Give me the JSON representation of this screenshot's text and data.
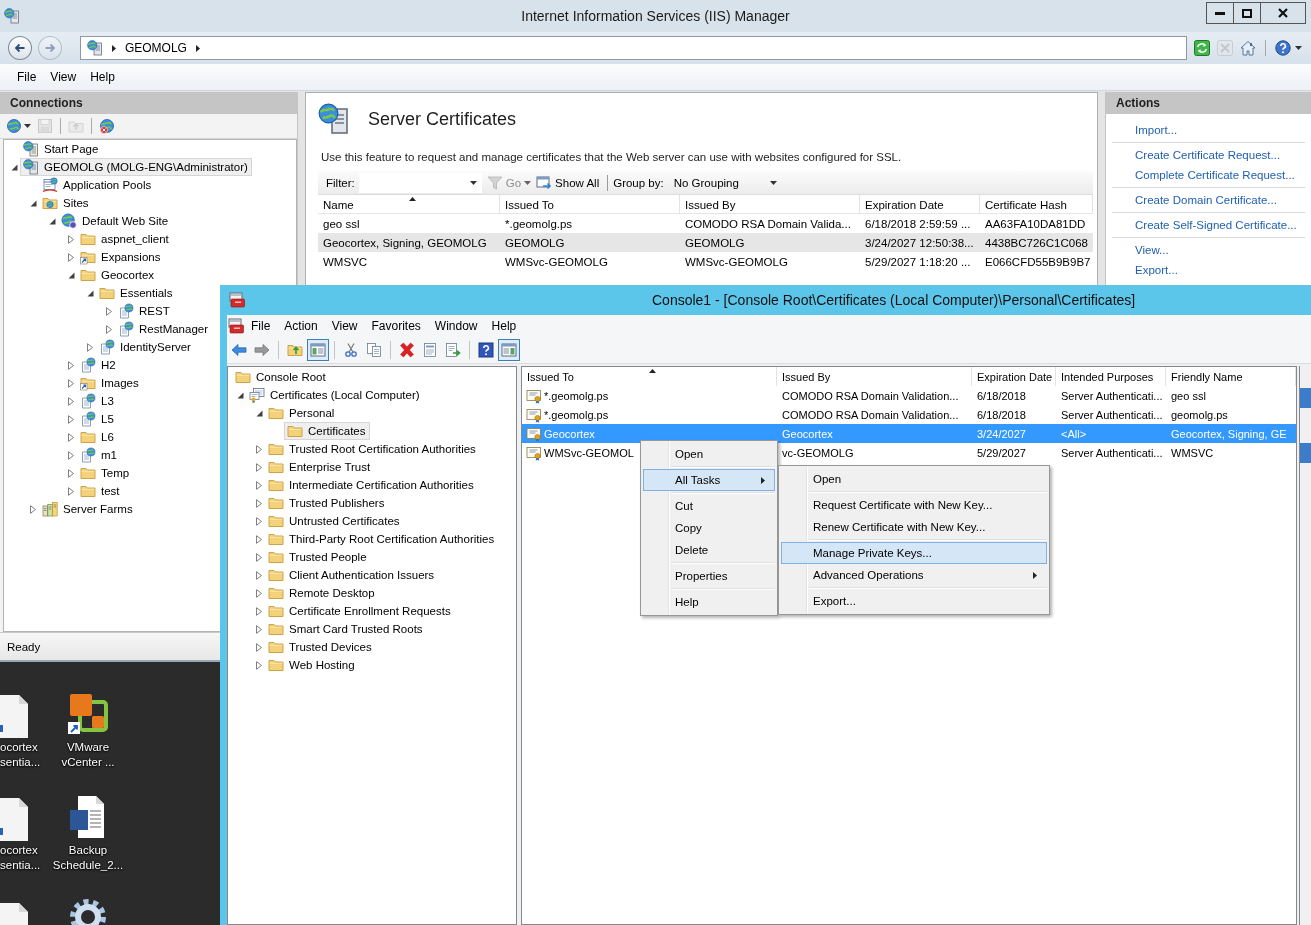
{
  "iis": {
    "title": "Internet Information Services (IIS) Manager",
    "nav": [
      {
        "kind": "back",
        "disabled": false
      },
      {
        "kind": "forward",
        "disabled": true
      }
    ],
    "address": [
      "GEOMOLG"
    ],
    "tools": [
      [
        {
          "kind": "refresh",
          "disabled": false
        },
        {
          "kind": "stop",
          "disabled": true
        },
        {
          "kind": "home",
          "disabled": false
        }
      ],
      [
        {
          "kind": "help",
          "disabled": false
        }
      ]
    ],
    "menu": [
      "File",
      "View",
      "Help"
    ],
    "connections": {
      "title": "Connections",
      "toolbar": [
        [
          {
            "kind": "connect",
            "disabled": false
          },
          {
            "kind": "save",
            "disabled": true
          }
        ],
        [
          {
            "kind": "up",
            "disabled": true
          }
        ],
        [
          {
            "kind": "disconnect",
            "disabled": false
          }
        ]
      ],
      "tree": [
        {
          "label": "Start Page",
          "kind": "start",
          "selected": false
        },
        {
          "label": "GEOMOLG (MOLG-ENG\\Administrator)",
          "kind": "server",
          "expanded": true,
          "selected": true,
          "children": [
            {
              "label": "Application Pools",
              "kind": "pools",
              "selected": false
            },
            {
              "label": "Sites",
              "kind": "sites",
              "expanded": true,
              "selected": false,
              "children": [
                {
                  "label": "Default Web Site",
                  "kind": "website",
                  "expanded": true,
                  "selected": false,
                  "children": [
                    {
                      "label": "aspnet_client",
                      "kind": "folder",
                      "expanded": false,
                      "selected": false
                    },
                    {
                      "label": "Expansions",
                      "kind": "vdir",
                      "expanded": false,
                      "selected": false
                    },
                    {
                      "label": "Geocortex",
                      "kind": "folder",
                      "expanded": true,
                      "selected": false,
                      "children": [
                        {
                          "label": "Essentials",
                          "kind": "folder",
                          "expanded": true,
                          "selected": false,
                          "children": [
                            {
                              "label": "REST",
                              "kind": "app",
                              "expanded": false,
                              "selected": false
                            },
                            {
                              "label": "RestManager",
                              "kind": "app",
                              "expanded": false,
                              "selected": false
                            }
                          ]
                        },
                        {
                          "label": "IdentityServer",
                          "kind": "app",
                          "expanded": false,
                          "selected": false
                        }
                      ]
                    },
                    {
                      "label": "H2",
                      "kind": "app",
                      "expanded": false,
                      "selected": false
                    },
                    {
                      "label": "Images",
                      "kind": "vdir",
                      "expanded": false,
                      "selected": false
                    },
                    {
                      "label": "L3",
                      "kind": "app",
                      "expanded": false,
                      "selected": false
                    },
                    {
                      "label": "L5",
                      "kind": "app",
                      "expanded": false,
                      "selected": false
                    },
                    {
                      "label": "L6",
                      "kind": "folder",
                      "expanded": false,
                      "selected": false
                    },
                    {
                      "label": "m1",
                      "kind": "app",
                      "expanded": false,
                      "selected": false
                    },
                    {
                      "label": "Temp",
                      "kind": "folder",
                      "expanded": false,
                      "selected": false
                    },
                    {
                      "label": "test",
                      "kind": "folder",
                      "expanded": false,
                      "selected": false
                    }
                  ]
                }
              ]
            },
            {
              "label": "Server Farms",
              "kind": "farm",
              "expanded": false,
              "selected": false
            }
          ]
        }
      ]
    },
    "feature": {
      "title": "Server Certificates",
      "description": "Use this feature to request and manage certificates that the Web server can use with websites configured for SSL.",
      "filter": {
        "label": "Filter:",
        "go": {
          "label": "Go",
          "disabled": true
        },
        "show_all": "Show All",
        "group_label": "Group by:",
        "group_value": "No Grouping"
      },
      "columns": [
        {
          "label": "Name",
          "sorted": true
        },
        {
          "label": "Issued To",
          "sorted": false
        },
        {
          "label": "Issued By",
          "sorted": false
        },
        {
          "label": "Expiration Date",
          "sorted": false
        },
        {
          "label": "Certificate Hash",
          "sorted": false
        }
      ],
      "rows": [
        {
          "selected": false,
          "cells": [
            "geo ssl",
            "*.geomolg.ps",
            "COMODO RSA Domain Valida...",
            "6/18/2018 2:59:59 ...",
            "AA63FA10DA81DD"
          ]
        },
        {
          "selected": true,
          "cells": [
            "Geocortex, Signing, GEOMOLG",
            "GEOMOLG",
            "GEOMOLG",
            "3/24/2027 12:50:38...",
            "4438BC726C1C068"
          ]
        },
        {
          "selected": false,
          "cells": [
            "WMSVC",
            "WMSvc-GEOMOLG",
            "WMSvc-GEOMOLG",
            "5/29/2027 1:18:20 ...",
            "E066CFD55B9B9B7"
          ]
        }
      ]
    },
    "actions": {
      "title": "Actions",
      "groups": [
        [
          "Import..."
        ],
        [
          "Create Certificate Request...",
          "Complete Certificate Request..."
        ],
        [
          "Create Domain Certificate..."
        ],
        [
          "Create Self-Signed Certificate..."
        ],
        [
          "View...",
          "Export..."
        ]
      ]
    },
    "status": "Ready"
  },
  "desktop": {
    "icons": [
      {
        "kind": "document",
        "label": "ocortex sentia..."
      },
      {
        "kind": "squares",
        "label": "VMware vCenter ..."
      },
      {
        "kind": "document",
        "label": "ocortex sentia..."
      },
      {
        "kind": "worddoc",
        "label": "Backup Schedule_2..."
      },
      {
        "kind": "document"
      },
      {
        "kind": "gear"
      }
    ]
  },
  "console": {
    "title": "Console1 - [Console Root\\Certificates (Local Computer)\\Personal\\Certificates]",
    "menu": [
      "File",
      "Action",
      "View",
      "Favorites",
      "Window",
      "Help"
    ],
    "toolbar": [
      [
        {
          "kind": "back",
          "pressed": false
        },
        {
          "kind": "forward",
          "pressed": false
        }
      ],
      [
        {
          "kind": "up",
          "pressed": false
        },
        {
          "kind": "tree",
          "pressed": true
        }
      ],
      [
        {
          "kind": "cut",
          "pressed": false
        },
        {
          "kind": "copy",
          "pressed": false
        }
      ],
      [
        {
          "kind": "delete",
          "pressed": false
        },
        {
          "kind": "properties",
          "pressed": false
        },
        {
          "kind": "export",
          "pressed": false
        }
      ],
      [
        {
          "kind": "help",
          "pressed": false
        },
        {
          "kind": "actionpane",
          "pressed": true
        }
      ]
    ],
    "tree": [
      {
        "label": "Console Root",
        "kind": "folder",
        "selected": false,
        "children": [
          {
            "label": "Certificates (Local Computer)",
            "kind": "store",
            "expanded": true,
            "selected": false,
            "children": [
              {
                "label": "Personal",
                "kind": "folder",
                "expanded": true,
                "selected": false,
                "children": [
                  {
                    "label": "Certificates",
                    "kind": "folder",
                    "selected": true
                  }
                ]
              },
              {
                "label": "Trusted Root Certification Authorities",
                "kind": "folder",
                "expanded": false,
                "selected": false
              },
              {
                "label": "Enterprise Trust",
                "kind": "folder",
                "expanded": false,
                "selected": false
              },
              {
                "label": "Intermediate Certification Authorities",
                "kind": "folder",
                "expanded": false,
                "selected": false
              },
              {
                "label": "Trusted Publishers",
                "kind": "folder",
                "expanded": false,
                "selected": false
              },
              {
                "label": "Untrusted Certificates",
                "kind": "folder",
                "expanded": false,
                "selected": false
              },
              {
                "label": "Third-Party Root Certification Authorities",
                "kind": "folder",
                "expanded": false,
                "selected": false
              },
              {
                "label": "Trusted People",
                "kind": "folder",
                "expanded": false,
                "selected": false
              },
              {
                "label": "Client Authentication Issuers",
                "kind": "folder",
                "expanded": false,
                "selected": false
              },
              {
                "label": "Remote Desktop",
                "kind": "folder",
                "expanded": false,
                "selected": false
              },
              {
                "label": "Certificate Enrollment Requests",
                "kind": "folder",
                "expanded": false,
                "selected": false
              },
              {
                "label": "Smart Card Trusted Roots",
                "kind": "folder",
                "expanded": false,
                "selected": false
              },
              {
                "label": "Trusted Devices",
                "kind": "folder",
                "expanded": false,
                "selected": false
              },
              {
                "label": "Web Hosting",
                "kind": "folder",
                "expanded": false,
                "selected": false
              }
            ]
          }
        ]
      }
    ],
    "columns": [
      {
        "label": "Issued To",
        "sorted": true
      },
      {
        "label": "Issued By",
        "sorted": false
      },
      {
        "label": "Expiration Date",
        "sorted": false
      },
      {
        "label": "Intended Purposes",
        "sorted": false
      },
      {
        "label": "Friendly Name",
        "sorted": false
      }
    ],
    "rows": [
      {
        "selected": false,
        "cells": [
          "*.geomolg.ps",
          "COMODO RSA Domain Validation...",
          "6/18/2018",
          "Server Authenticati...",
          "geo ssl"
        ]
      },
      {
        "selected": false,
        "cells": [
          "*.geomolg.ps",
          "COMODO RSA Domain Validation...",
          "6/18/2018",
          "Server Authenticati...",
          "geomolg.ps"
        ]
      },
      {
        "selected": true,
        "cells": [
          "Geocortex",
          "Geocortex",
          "3/24/2027",
          "<All>",
          "Geocortex, Signing, GE"
        ]
      },
      {
        "selected": false,
        "cells": [
          "WMSvc-GEOMOL",
          "vc-GEOMOLG",
          "5/29/2027",
          "Server Authenticati...",
          "WMSVC"
        ]
      }
    ],
    "context_menu": {
      "groups": [
        [
          {
            "label": "Open",
            "selected": false,
            "has_submenu": false
          }
        ],
        [
          {
            "label": "All Tasks",
            "selected": true,
            "has_submenu": true
          }
        ],
        [
          {
            "label": "Cut",
            "selected": false,
            "has_submenu": false
          },
          {
            "label": "Copy",
            "selected": false,
            "has_submenu": false
          },
          {
            "label": "Delete",
            "selected": false,
            "has_submenu": false
          }
        ],
        [
          {
            "label": "Properties",
            "selected": false,
            "has_submenu": false
          }
        ],
        [
          {
            "label": "Help",
            "selected": false,
            "has_submenu": false
          }
        ]
      ]
    },
    "submenu": {
      "groups": [
        [
          {
            "label": "Open",
            "selected": false,
            "has_submenu": false
          }
        ],
        [
          {
            "label": "Request Certificate with New Key...",
            "selected": false,
            "has_submenu": false
          },
          {
            "label": "Renew Certificate with New Key...",
            "selected": false,
            "has_submenu": false
          }
        ],
        [
          {
            "label": "Manage Private Keys...",
            "selected": true,
            "has_submenu": false
          },
          {
            "label": "Advanced Operations",
            "selected": false,
            "has_submenu": true
          }
        ],
        [
          {
            "label": "Export...",
            "selected": false,
            "has_submenu": false
          }
        ]
      ]
    }
  }
}
